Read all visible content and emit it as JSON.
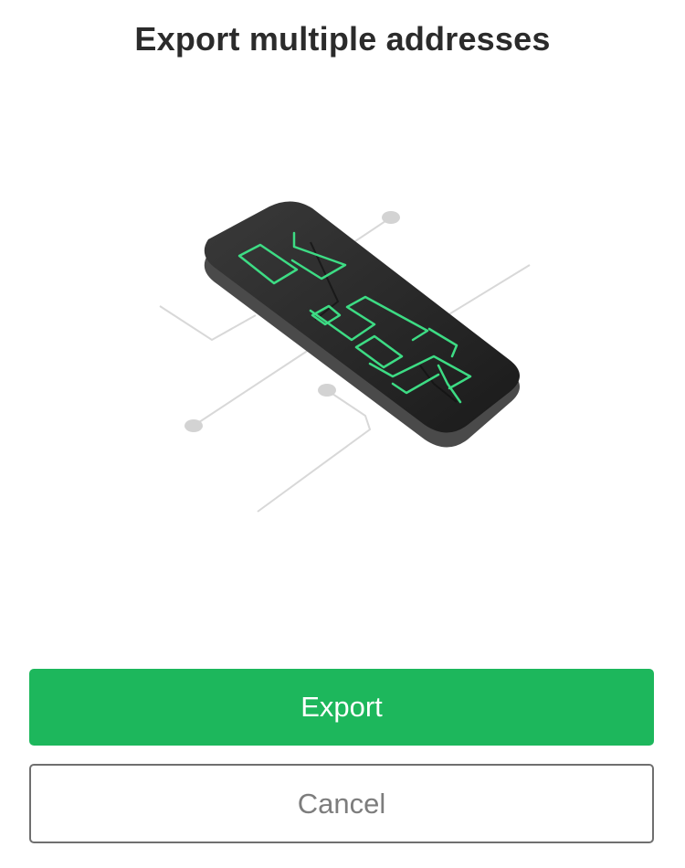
{
  "header": {
    "title": "Export multiple addresses"
  },
  "actions": {
    "export_label": "Export",
    "cancel_label": "Cancel"
  },
  "colors": {
    "accent": "#1db75c",
    "device_body": "#2a2a2a",
    "circuit_line": "#3ddc84"
  },
  "illustration": {
    "icon": "hardware-wallet-icon"
  }
}
